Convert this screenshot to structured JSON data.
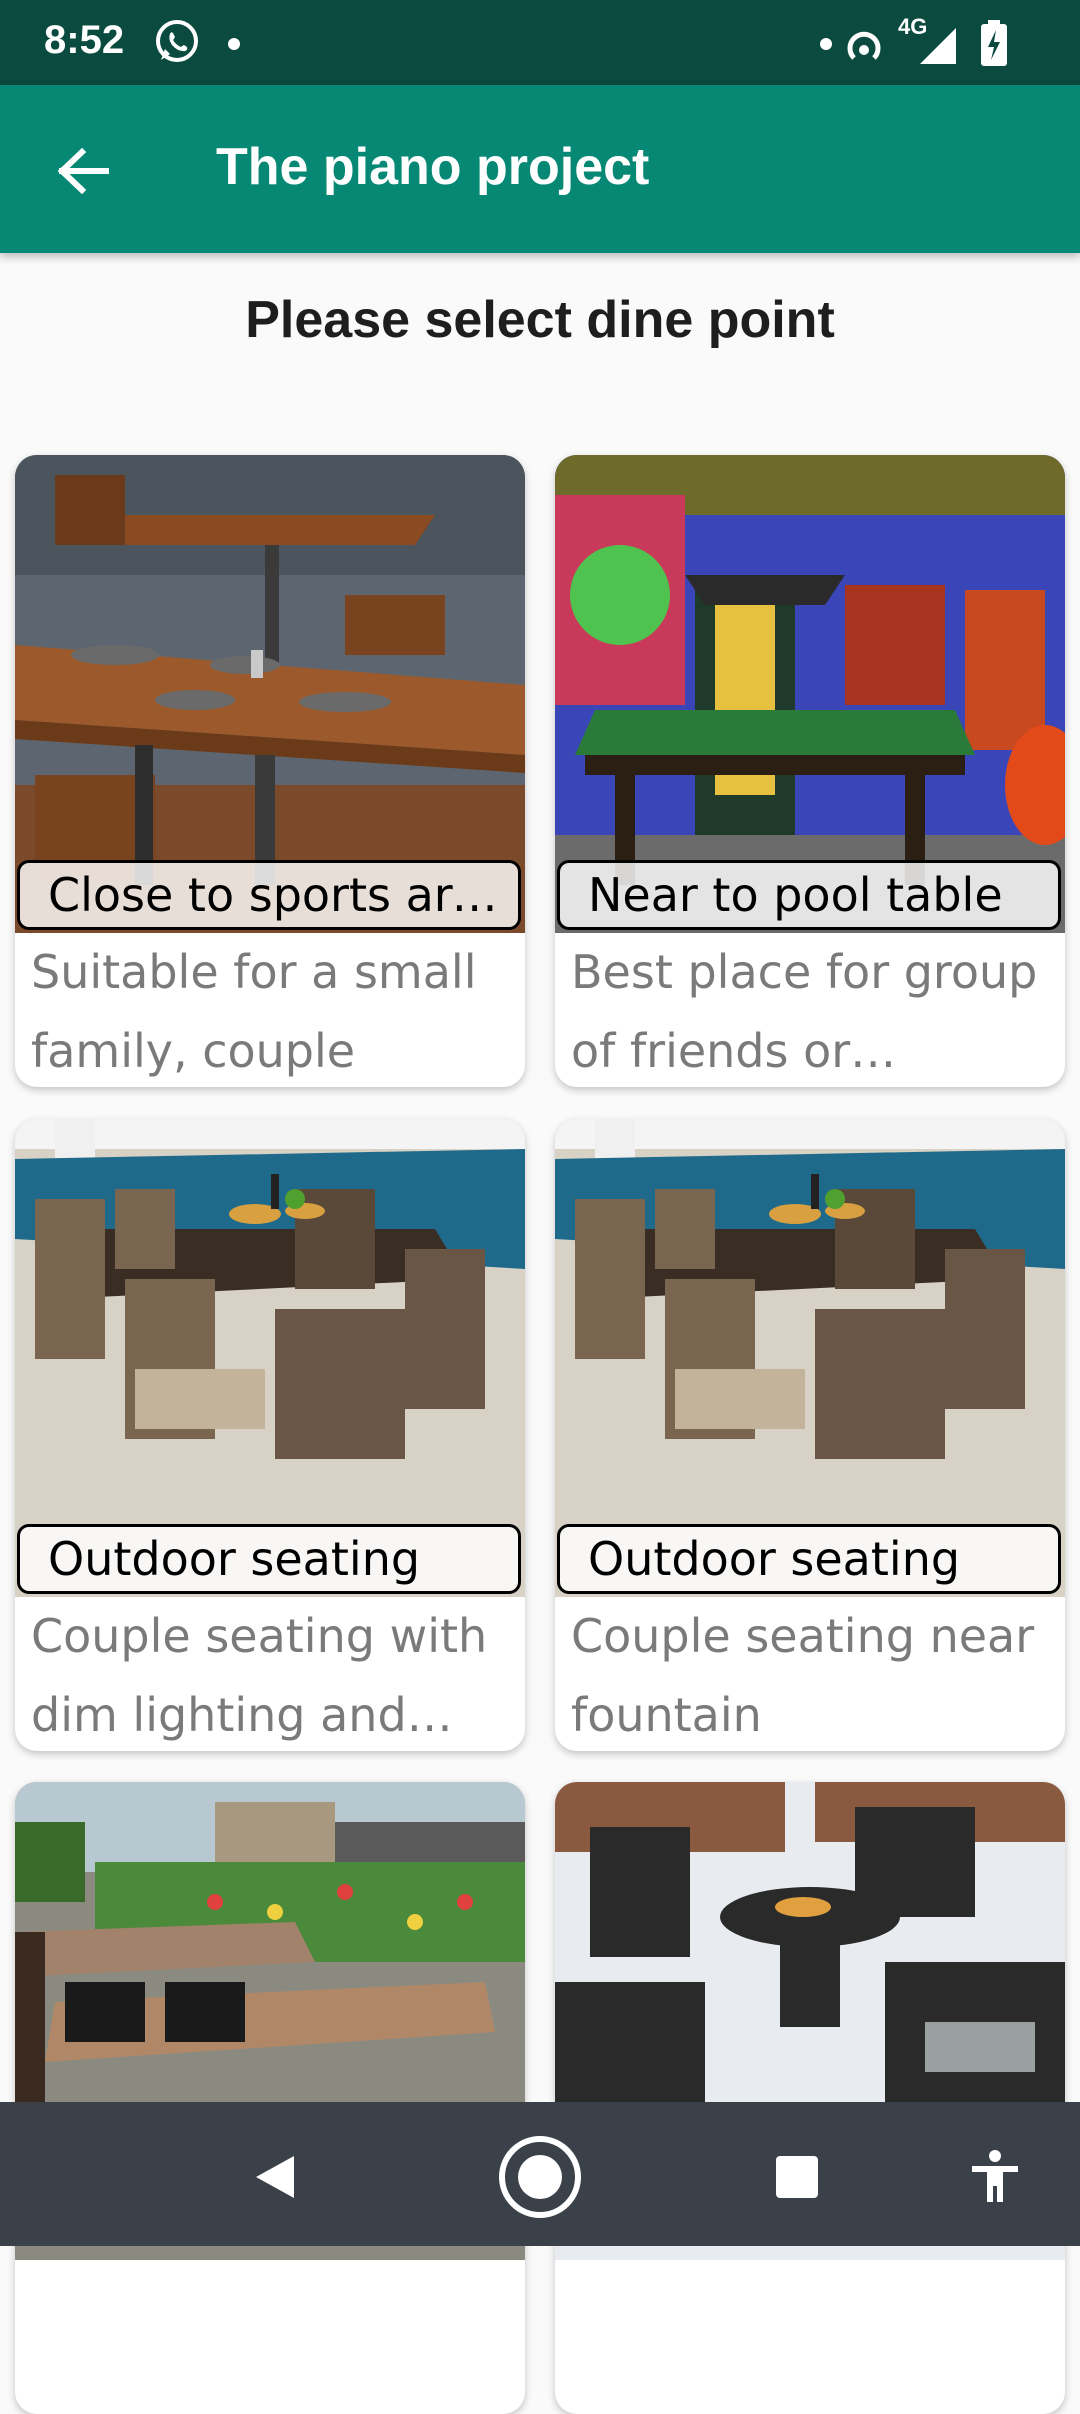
{
  "status_bar": {
    "time": "8:52",
    "network": "4G",
    "left_icons": [
      "whatsapp-icon",
      "dot-icon"
    ],
    "right_icons": [
      "dot-icon",
      "hotspot-icon",
      "signal-icon",
      "battery-charging-icon"
    ]
  },
  "app_bar": {
    "title": "The piano project",
    "back_icon": "arrow-back-icon",
    "color": "#078874"
  },
  "page": {
    "heading": "Please select dine point"
  },
  "cards": [
    {
      "label": "Close to sports arena",
      "description": "Suitable for a small family, couple",
      "image": "wooden-tables-restaurant"
    },
    {
      "label": "Near to pool table",
      "description": "Best place for group of friends or colleagues",
      "image": "pool-table-room"
    },
    {
      "label": "Outdoor seating",
      "description": "Couple seating with dim lighting and music",
      "image": "poolside-wicker-dining-set"
    },
    {
      "label": "Outdoor seating",
      "description": "Couple seating near fountain",
      "image": "poolside-wicker-dining-set"
    },
    {
      "label": "",
      "description": "",
      "image": "street-garden-tables"
    },
    {
      "label": "",
      "description": "",
      "image": "wicker-round-table-set"
    }
  ],
  "nav_bar": {
    "buttons": [
      "back-triangle-icon",
      "home-circle-icon",
      "recents-square-icon",
      "accessibility-icon"
    ]
  }
}
